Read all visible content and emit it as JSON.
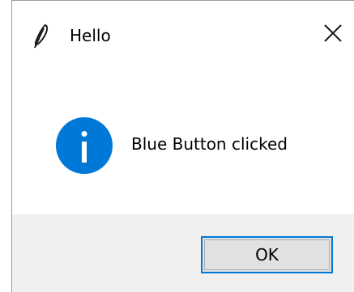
{
  "window": {
    "title": "Hello",
    "close_icon": "close-icon",
    "app_icon": "feather-icon"
  },
  "message": {
    "icon": "info-icon",
    "text": "Blue Button clicked"
  },
  "buttons": {
    "ok_label": "OK"
  },
  "colors": {
    "info_icon_fill": "#0078d7",
    "button_focus_border": "#0078d7",
    "button_fill": "#e1e1e1",
    "footer_bg": "#f0f0f0"
  }
}
